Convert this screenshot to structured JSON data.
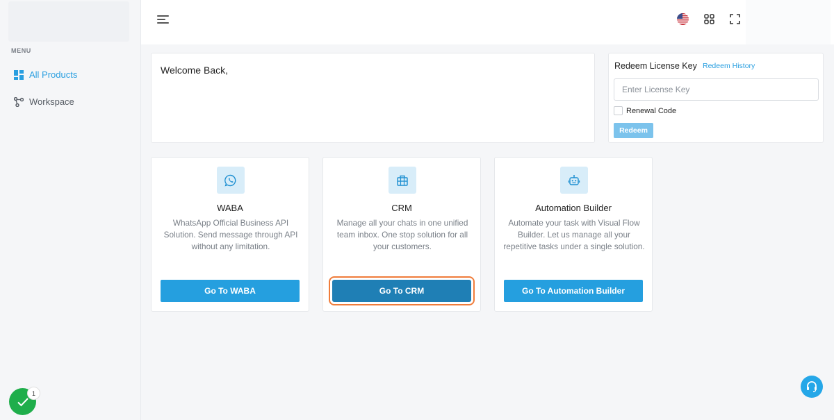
{
  "sidebar": {
    "menu_label": "MENU",
    "items": [
      {
        "label": "All Products",
        "icon": "grid-icon",
        "active": true
      },
      {
        "label": "Workspace",
        "icon": "share-nodes-icon",
        "active": false
      }
    ]
  },
  "header": {
    "language_icon": "us-flag-icon",
    "apps_icon": "apps-grid-icon",
    "fullscreen_icon": "fullscreen-icon"
  },
  "welcome": {
    "text": "Welcome Back,"
  },
  "redeem": {
    "title": "Redeem License Key",
    "history_link": "Redeem History",
    "input_placeholder": "Enter License Key",
    "input_value": "",
    "renewal_label": "Renewal Code",
    "renewal_checked": false,
    "button_label": "Redeem"
  },
  "products": [
    {
      "title": "WABA",
      "description": "WhatsApp Official Business API Solution. Send message through API without any limitation.",
      "button": "Go To WABA",
      "icon": "whatsapp-icon"
    },
    {
      "title": "CRM",
      "description": "Manage all your chats in one unified team inbox. One stop solution for all your customers.",
      "button": "Go To CRM",
      "icon": "briefcase-icon"
    },
    {
      "title": "Automation Builder",
      "description": "Automate your task with Visual Flow Builder. Let us manage all your repetitive tasks under a single solution.",
      "button": "Go To Automation Builder",
      "icon": "robot-icon"
    }
  ],
  "notification": {
    "count": "1"
  },
  "colors": {
    "accent": "#259fdf",
    "active_button": "#1f7fb5",
    "focus_ring": "#f07c3a",
    "success": "#1fae4b"
  }
}
